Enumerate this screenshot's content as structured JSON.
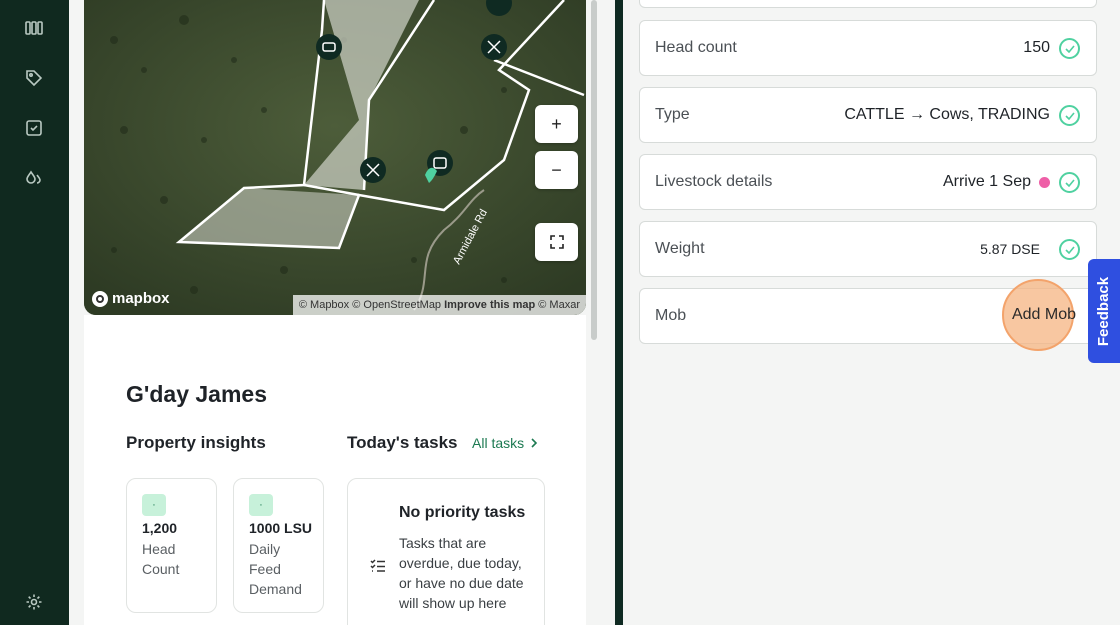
{
  "map": {
    "logo_text": "mapbox",
    "zoom_in": "+",
    "zoom_out": "−",
    "attribution": {
      "mapbox": "© Mapbox",
      "osm": "© OpenStreetMap",
      "improve": "Improve this map",
      "maxar": "© Maxar"
    },
    "road_label": "Armidale Rd"
  },
  "dashboard": {
    "greeting": "G'day James",
    "insights_title": "Property insights",
    "tasks_title": "Today's tasks",
    "all_tasks_link": "All tasks",
    "stats": [
      {
        "badge": "·",
        "value": "1,200",
        "label": "Head Count"
      },
      {
        "badge": "·",
        "value": "1000  LSU",
        "label": "Daily Feed Demand"
      }
    ],
    "tasks_card": {
      "title": "No priority tasks",
      "body": "Tasks that are overdue, due today, or have no due date will show up here"
    }
  },
  "form": {
    "fields": [
      {
        "label": "Head count",
        "value": "150"
      },
      {
        "label": "Type",
        "value": "CATTLE → Cows, TRADING"
      },
      {
        "label": "Livestock details",
        "value": "Arrive 1 Sep"
      },
      {
        "label": "Weight",
        "value": "5.87 DSE"
      },
      {
        "label": "Mob",
        "value": "Add Mob"
      }
    ]
  },
  "feedback_label": "Feedback",
  "colors": {
    "rail": "#10291f",
    "accent_green": "#4fd1a0",
    "link_green": "#1d7a52",
    "pink_dot": "#ee5fa7",
    "feedback_blue": "#2f4fe0",
    "highlight_orange": "#f3a36b"
  },
  "icons": {
    "rail": [
      "grid-icon",
      "tag-icon",
      "checkbox-icon",
      "drops-icon",
      "settings-icon"
    ]
  }
}
